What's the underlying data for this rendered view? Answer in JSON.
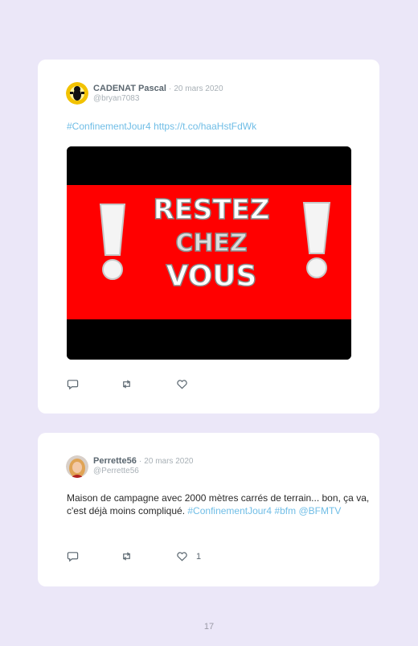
{
  "tweets": [
    {
      "author": "CADENAT Pascal",
      "separator": "·",
      "date": "20 mars 2020",
      "handle": "@bryan7083",
      "text_links": "#ConfinementJour4 https://t.co/haaHstFdWk",
      "image": {
        "line1": "RESTEZ",
        "line2": "CHEZ",
        "line3": "VOUS",
        "bang": "!"
      },
      "likes": ""
    },
    {
      "author": "Perrette56",
      "separator": "·",
      "date": "20 mars 2020",
      "handle": "@Perrette56",
      "text_plain": "Maison de campagne avec 2000 mètres carrés de terrain... bon, ça va, c'est déjà moins compliqué.",
      "text_tag1": "#ConfinementJour4",
      "text_tag2": "#bfm",
      "text_mention": "@BFMTV",
      "likes": "1"
    }
  ],
  "page_number": "17",
  "colors": {
    "background": "#ebe7f8",
    "link": "#6fbde6",
    "banner_red": "#ff0000"
  },
  "icons": [
    "reply-icon",
    "retweet-icon",
    "like-icon"
  ]
}
